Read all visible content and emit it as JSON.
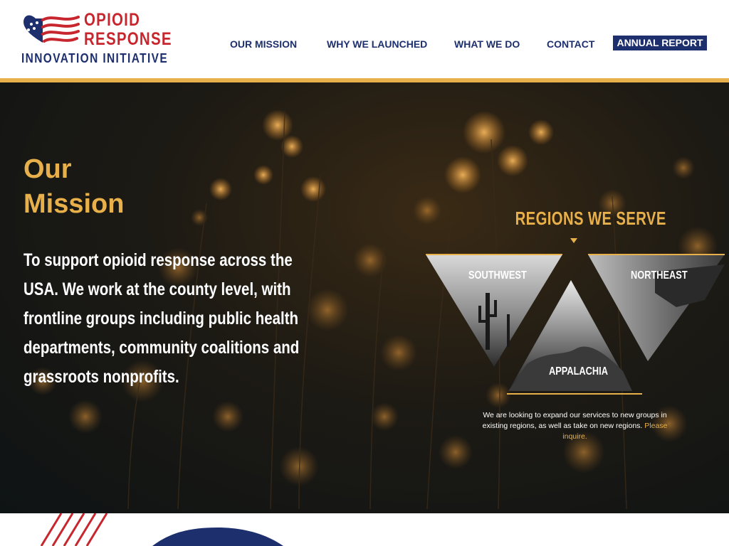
{
  "brand": {
    "line1": "OPIOID",
    "line2": "RESPONSE",
    "line3": "INNOVATION INITIATIVE",
    "red": "#c8262e",
    "navy": "#1e2f6e",
    "gold": "#e8b04a"
  },
  "nav": {
    "items": [
      {
        "label": "OUR MISSION",
        "active": true
      },
      {
        "label": "WHY WE LAUNCHED",
        "active": false
      },
      {
        "label": "WHAT WE DO",
        "active": false
      },
      {
        "label": "CONTACT",
        "active": false
      }
    ],
    "annual_report": "ANNUAL REPORT"
  },
  "mission": {
    "title_line1": "Our",
    "title_line2": "Mission",
    "body": "To support opioid response across the USA. We work at the county level, with frontline groups including public health departments, community coalitions and grassroots nonprofits."
  },
  "regions": {
    "title": "REGIONS WE SERVE",
    "items": [
      {
        "name": "SOUTHWEST"
      },
      {
        "name": "APPALACHIA"
      },
      {
        "name": "NORTHEAST"
      }
    ],
    "note_text": "We are looking to expand our services to new groups in existing regions, as well as take on new regions.",
    "note_link": "Please inquire."
  }
}
